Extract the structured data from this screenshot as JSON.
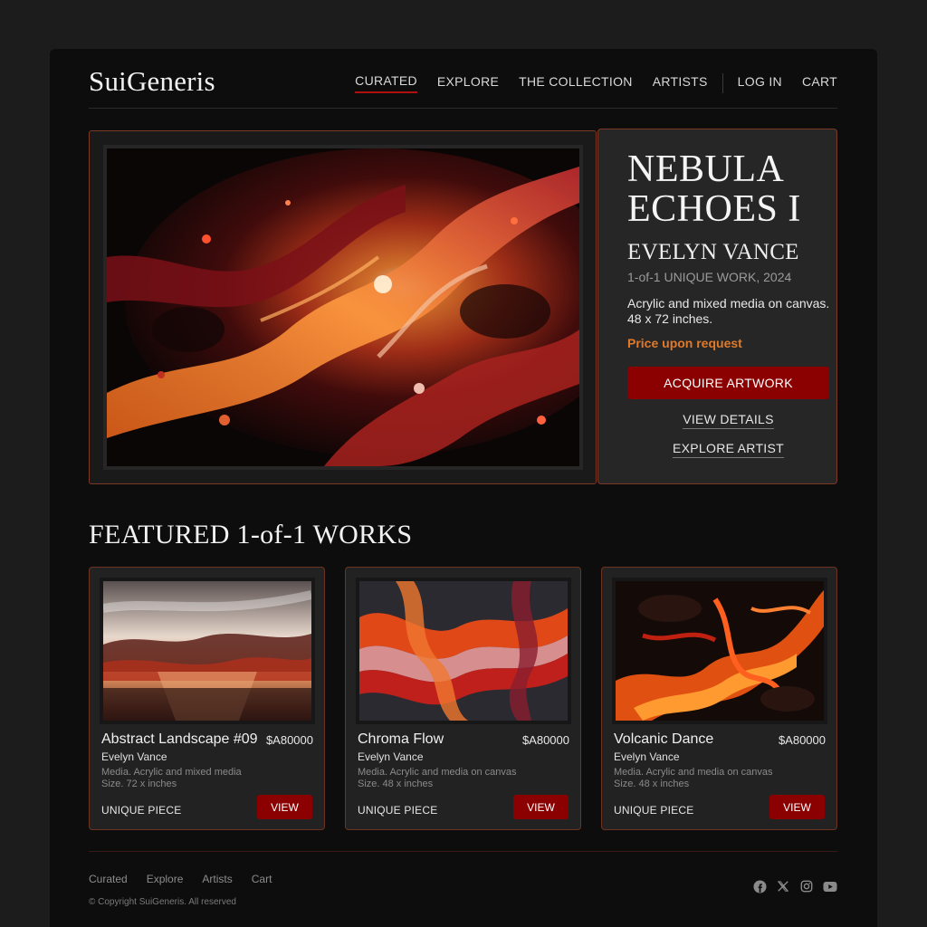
{
  "header": {
    "logo": "SuiGeneris",
    "nav": [
      "CURATED",
      "EXPLORE",
      "THE COLLECTION",
      "ARTISTS"
    ],
    "active_nav": "CURATED",
    "account": [
      "LOG IN",
      "CART"
    ]
  },
  "hero": {
    "title_line1": "NEBULA",
    "title_line2": "ECHOES I",
    "artist": "EVELYN VANCE",
    "edition": "1-of-1 UNIQUE WORK, 2024",
    "desc_line1": "Acrylic and mixed media on canvas.",
    "desc_line2": "48 x 72 inches.",
    "price": "Price upon request",
    "acquire_label": "ACQUIRE ARTWORK",
    "details_label": "VIEW DETAILS",
    "artist_link_label": "EXPLORE ARTIST"
  },
  "featured": {
    "title": "FEATURED 1-of-1 WORKS",
    "cards": [
      {
        "name": "Abstract Landscape #09",
        "price": "$A80000",
        "artist": "Evelyn Vance",
        "media": "Media. Acrylic and mixed media",
        "size": "Size. 72 x inches",
        "badge": "UNIQUE PIECE",
        "view": "VIEW"
      },
      {
        "name": "Chroma Flow",
        "price": "$A80000",
        "artist": "Evelyn Vance",
        "media": "Media. Acrylic and media on canvas",
        "size": "Size. 48 x inches",
        "badge": "UNIQUE PIECE",
        "view": "VIEW"
      },
      {
        "name": "Volcanic Dance",
        "price": "$A80000",
        "artist": "Evelyn Vance",
        "media": "Media. Acrylic and media on canvas",
        "size": "Size. 48 x inches",
        "badge": "UNIQUE PIECE",
        "view": "VIEW"
      }
    ]
  },
  "footer": {
    "links": [
      "Curated",
      "Explore",
      "Artists",
      "Cart"
    ],
    "copyright": "© Copyright SuiGeneris. All reserved",
    "socials": [
      "facebook-icon",
      "x-icon",
      "instagram-icon",
      "youtube-icon"
    ]
  },
  "colors": {
    "accent_red": "#8b0000",
    "price_orange": "#e07a2a",
    "border_rust": "#7a3a25",
    "background": "#0d0d0d"
  }
}
